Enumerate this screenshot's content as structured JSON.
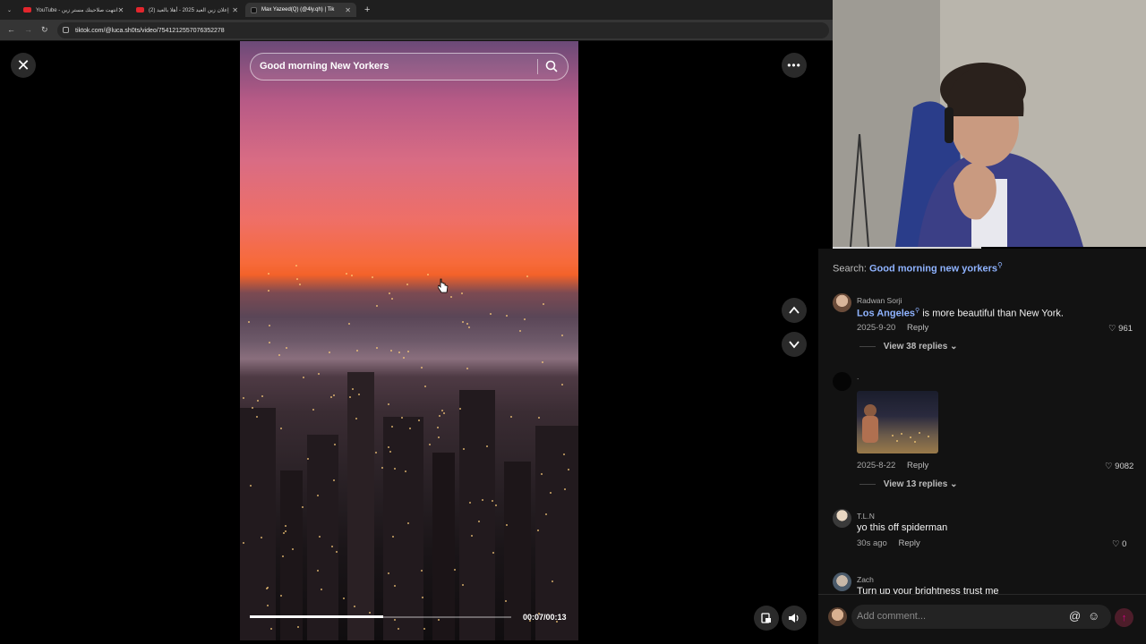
{
  "browser": {
    "tabs": [
      {
        "label": "YouTube - انتهت صلاحيتك مستر زين"
      },
      {
        "label": "(2) إعلان زين العيد 2025 - أهلا بالعيد"
      },
      {
        "label": "Max Yazeed(Q) (@4ly.qh) | Tik"
      }
    ],
    "url": "tiktok.com/@luca.sh0ts/video/7541212557076352278"
  },
  "video": {
    "search_query": "Good morning New Yorkers",
    "time": "00:07/00:13",
    "progress": 0.51
  },
  "comments_section": {
    "search_prefix": "Search:",
    "search_link": "Good morning new yorkers",
    "comments": [
      {
        "user": "Radwan Sorji",
        "link": "Los Angeles",
        "text": " is more beautiful than New York.",
        "date": "2025-9-20",
        "reply_label": "Reply",
        "likes": "961",
        "view_replies": "View 38 replies"
      },
      {
        "user": ".",
        "date": "2025-8-22",
        "reply_label": "Reply",
        "likes": "9082",
        "view_replies": "View 13 replies"
      },
      {
        "user": "T.L.N",
        "text": "yo this off spiderman",
        "date": "30s ago",
        "reply_label": "Reply",
        "likes": "0"
      },
      {
        "user": "Zach",
        "text": "Turn up your brightness trust me"
      }
    ],
    "add_comment_placeholder": "Add comment..."
  },
  "colors": {
    "link": "#8fb3ff",
    "send": "#4d1d2a"
  }
}
